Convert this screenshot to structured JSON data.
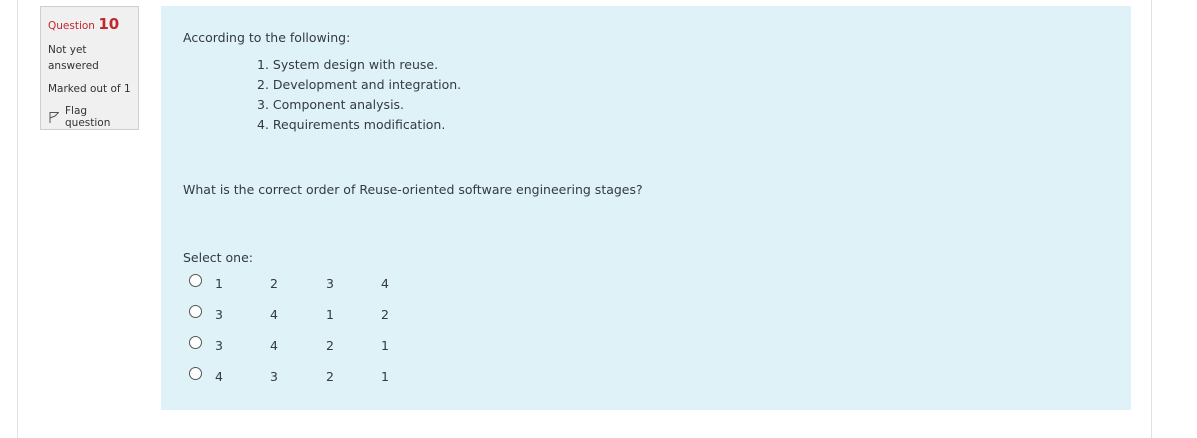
{
  "info": {
    "question_prefix": "Question",
    "question_number": "10",
    "state_line1": "Not yet",
    "state_line2": "answered",
    "grade": "Marked out of 1",
    "flag_label": "Flag question",
    "flag_icon": "flag-icon"
  },
  "question": {
    "intro": "According to the following:",
    "steps": [
      "1. System design with reuse.",
      "2. Development and integration.",
      "3. Component analysis.",
      "4. Requirements modification."
    ],
    "text": "What is the correct order of Reuse-oriented software engineering stages?",
    "prompt": "Select one:",
    "options": [
      [
        "1",
        "2",
        "3",
        "4"
      ],
      [
        "3",
        "4",
        "1",
        "2"
      ],
      [
        "3",
        "4",
        "2",
        "1"
      ],
      [
        "4",
        "3",
        "2",
        "1"
      ]
    ]
  },
  "colors": {
    "question_number": "#c0282d",
    "content_background": "#def2f8",
    "info_background": "#f0f0f0"
  }
}
